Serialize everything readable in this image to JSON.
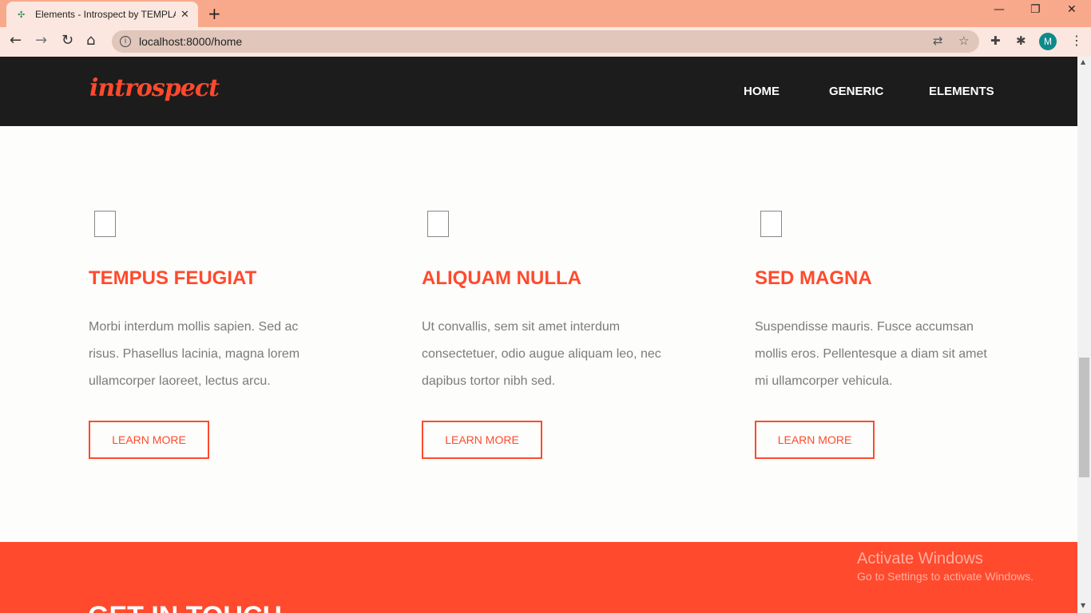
{
  "browser": {
    "tab_title": "Elements - Introspect by TEMPLATED",
    "tab_favicon": "✣",
    "tab_close": "✕",
    "new_tab": "+",
    "minimize": "—",
    "maximize": "❐",
    "close": "✕",
    "back": "←",
    "forward": "→",
    "reload": "↻",
    "home": "⌂",
    "url": "localhost:8000/home",
    "translate_icon": "⇄",
    "star_icon": "☆",
    "extension_icon": "✚",
    "puzzle_icon": "✱",
    "profile_initial": "M",
    "menu": "⋮"
  },
  "site": {
    "logo": "introspect",
    "nav": [
      "HOME",
      "GENERIC",
      "ELEMENTS"
    ]
  },
  "features": [
    {
      "title": "TEMPUS FEUGIAT",
      "text": "Morbi interdum mollis sapien. Sed ac risus. Phasellus lacinia, magna lorem ullamcorper laoreet, lectus arcu.",
      "button": "LEARN MORE"
    },
    {
      "title": "ALIQUAM NULLA",
      "text": "Ut convallis, sem sit amet interdum consectetuer, odio augue aliquam leo, nec dapibus tortor nibh sed.",
      "button": "LEARN MORE"
    },
    {
      "title": "SED MAGNA",
      "text": "Suspendisse mauris. Fusce accumsan mollis eros. Pellentesque a diam sit amet mi ullamcorper vehicula.",
      "button": "LEARN MORE"
    }
  ],
  "contact": {
    "title": "GET IN TOUCH"
  },
  "watermark": {
    "title": "Activate Windows",
    "subtitle": "Go to Settings to activate Windows."
  },
  "scrollbar": {
    "up": "▲",
    "down": "▼"
  },
  "colors": {
    "accent": "#ff4a2d",
    "header_bg": "#1c1c1c",
    "chrome_bg": "#f9a98b"
  }
}
